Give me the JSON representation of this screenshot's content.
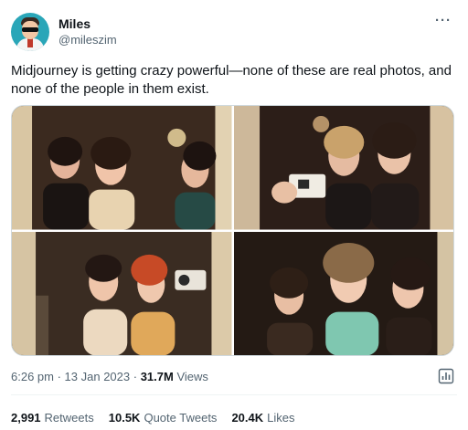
{
  "author": {
    "name": "Miles",
    "handle": "@mileszim"
  },
  "more_icon": "more-horizontal-icon",
  "tweet": {
    "text": "Midjourney is getting crazy powerful—none of these are real photos, and none of the people in them exist."
  },
  "media": {
    "count": 4
  },
  "meta": {
    "time": "6:26 pm",
    "sep1": " · ",
    "date": "13 Jan 2023",
    "sep2": " · ",
    "views_count": "31.7M",
    "views_label": " Views"
  },
  "analytics_icon": "analytics-icon",
  "stats": {
    "retweets": {
      "count": "2,991",
      "label": "Retweets"
    },
    "quotes": {
      "count": "10.5K",
      "label": "Quote Tweets"
    },
    "likes": {
      "count": "20.4K",
      "label": "Likes"
    }
  },
  "colors": {
    "text_primary": "#0f1419",
    "text_secondary": "#536471",
    "avatar_bg": "#2aa6b8"
  }
}
